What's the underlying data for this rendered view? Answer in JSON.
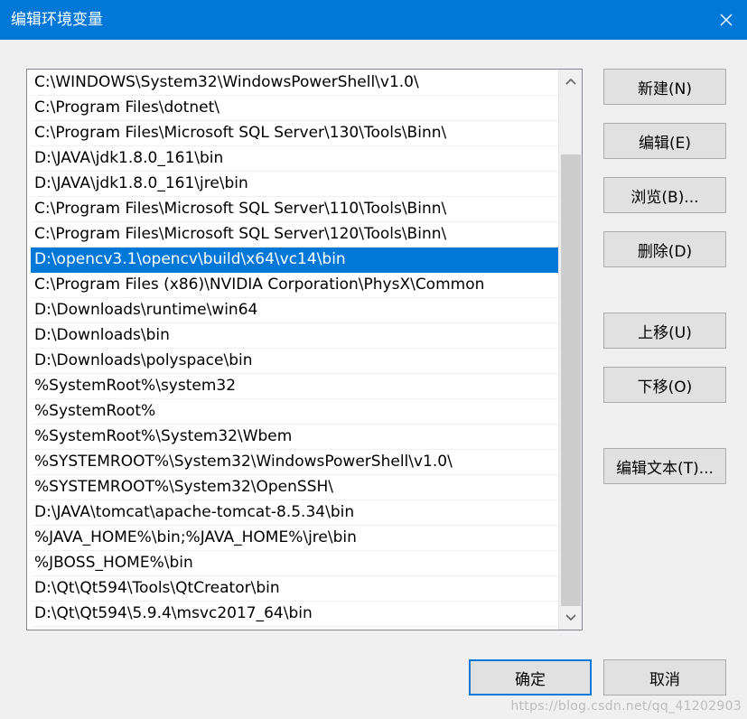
{
  "window": {
    "title": "编辑环境变量",
    "close_icon": "close-icon"
  },
  "path_list": {
    "selected_index": 7,
    "items": [
      "C:\\WINDOWS\\System32\\WindowsPowerShell\\v1.0\\",
      "C:\\Program Files\\dotnet\\",
      "C:\\Program Files\\Microsoft SQL Server\\130\\Tools\\Binn\\",
      "D:\\JAVA\\jdk1.8.0_161\\bin",
      "D:\\JAVA\\jdk1.8.0_161\\jre\\bin",
      "C:\\Program Files\\Microsoft SQL Server\\110\\Tools\\Binn\\",
      "C:\\Program Files\\Microsoft SQL Server\\120\\Tools\\Binn\\",
      "D:\\opencv3.1\\opencv\\build\\x64\\vc14\\bin",
      "C:\\Program Files (x86)\\NVIDIA Corporation\\PhysX\\Common",
      "D:\\Downloads\\runtime\\win64",
      "D:\\Downloads\\bin",
      "D:\\Downloads\\polyspace\\bin",
      "%SystemRoot%\\system32",
      "%SystemRoot%",
      "%SystemRoot%\\System32\\Wbem",
      "%SYSTEMROOT%\\System32\\WindowsPowerShell\\v1.0\\",
      "%SYSTEMROOT%\\System32\\OpenSSH\\",
      "D:\\JAVA\\tomcat\\apache-tomcat-8.5.34\\bin",
      "%JAVA_HOME%\\bin;%JAVA_HOME%\\jre\\bin",
      "%JBOSS_HOME%\\bin",
      "D:\\Qt\\Qt594\\Tools\\QtCreator\\bin",
      "D:\\Qt\\Qt594\\5.9.4\\msvc2017_64\\bin"
    ]
  },
  "buttons": {
    "new": "新建(N)",
    "edit": "编辑(E)",
    "browse": "浏览(B)...",
    "delete": "删除(D)",
    "move_up": "上移(U)",
    "move_down": "下移(O)",
    "edit_text": "编辑文本(T)...",
    "ok": "确定",
    "cancel": "取消"
  },
  "watermark": "https://blog.csdn.net/qq_41202903",
  "colors": {
    "title_bar": "#0078d7",
    "selection": "#0078d7",
    "dialog_bg": "#f0f0f0",
    "button_bg": "#e1e1e1"
  }
}
